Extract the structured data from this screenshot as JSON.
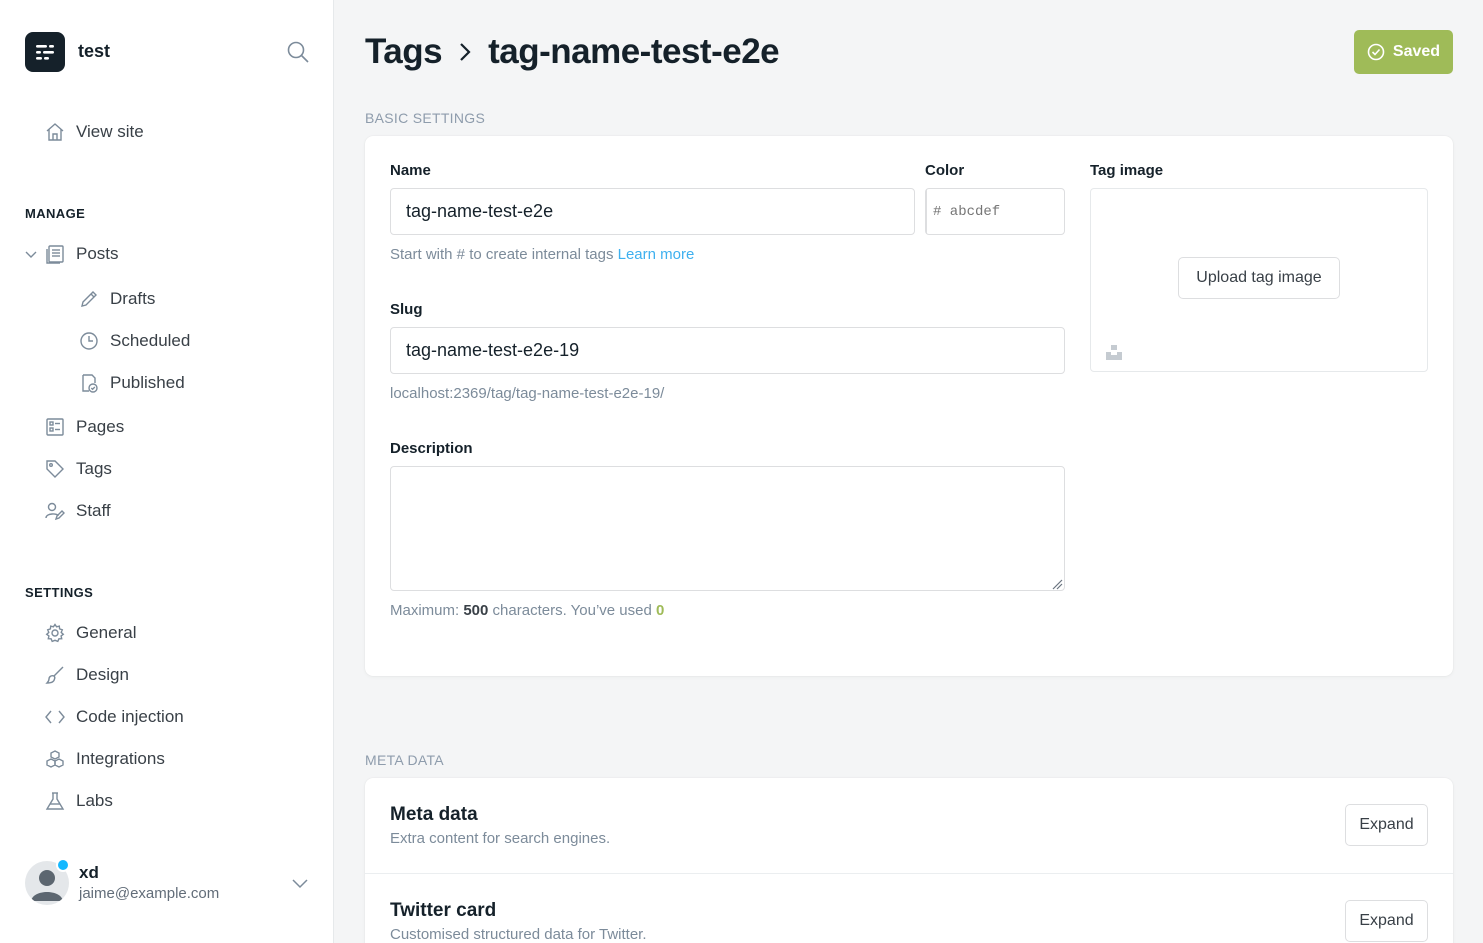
{
  "sidebar": {
    "site_name": "test",
    "view_site": "View site",
    "manage_heading": "MANAGE",
    "manage_items": {
      "posts": "Posts",
      "drafts": "Drafts",
      "scheduled": "Scheduled",
      "published": "Published",
      "pages": "Pages",
      "tags": "Tags",
      "staff": "Staff"
    },
    "settings_heading": "SETTINGS",
    "settings_items": {
      "general": "General",
      "design": "Design",
      "code_injection": "Code injection",
      "integrations": "Integrations",
      "labs": "Labs"
    },
    "user": {
      "name": "xd",
      "email": "jaime@example.com"
    }
  },
  "header": {
    "breadcrumb_parent": "Tags",
    "breadcrumb_current": "tag-name-test-e2e",
    "saved_label": "Saved"
  },
  "basic_settings": {
    "section_label": "BASIC SETTINGS",
    "name_label": "Name",
    "name_value": "tag-name-test-e2e",
    "name_hint": "Start with # to create internal tags",
    "name_hint_link": "Learn more",
    "color_label": "Color",
    "color_placeholder": "# abcdef",
    "tag_image_label": "Tag image",
    "upload_label": "Upload tag image",
    "slug_label": "Slug",
    "slug_value": "tag-name-test-e2e-19",
    "slug_url": "localhost:2369/tag/tag-name-test-e2e-19/",
    "description_label": "Description",
    "description_value": "",
    "max_prefix": "Maximum:",
    "max_count": "500",
    "max_middle": "characters. You’ve used",
    "used_count": "0"
  },
  "meta_data": {
    "section_label": "META DATA",
    "rows": [
      {
        "title": "Meta data",
        "desc": "Extra content for search engines.",
        "button": "Expand"
      },
      {
        "title": "Twitter card",
        "desc": "Customised structured data for Twitter.",
        "button": "Expand"
      }
    ]
  },
  "colors": {
    "saved_green": "#9fbb58",
    "link_blue": "#3eb0ef",
    "status_dot": "#14b8ff"
  }
}
